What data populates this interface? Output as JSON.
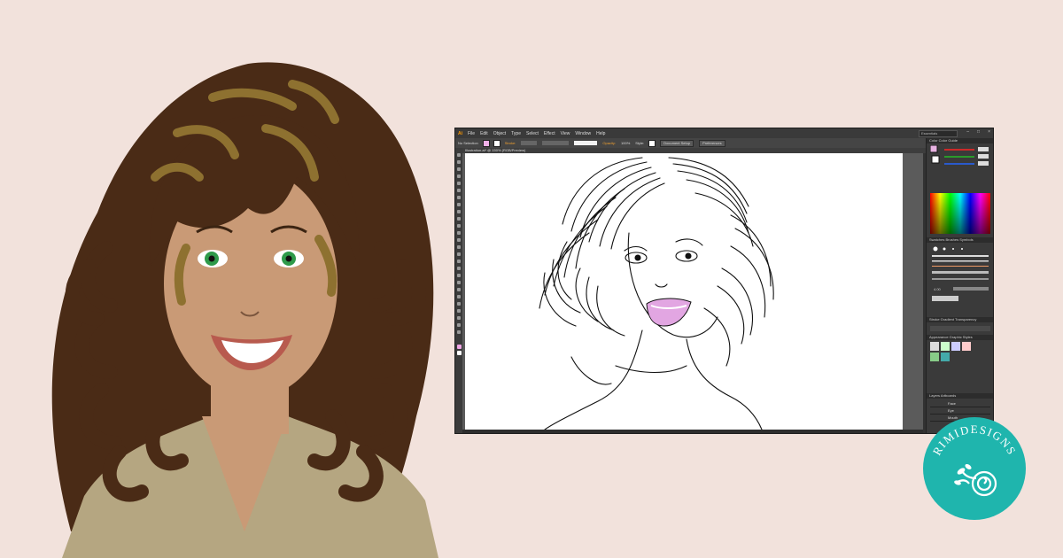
{
  "app": {
    "logo": "Ai",
    "menu": [
      "File",
      "Edit",
      "Object",
      "Type",
      "Select",
      "Effect",
      "View",
      "Window",
      "Help"
    ],
    "workspace": "Essentials",
    "window_controls": [
      "–",
      "□",
      "×"
    ]
  },
  "control_bar": {
    "selection": "No Selection",
    "stroke_label": "Stroke:",
    "opacity_label": "Opacity:",
    "opacity_value": "100%",
    "style_label": "Style:",
    "document_setup": "Document Setup",
    "preferences": "Preferences"
  },
  "document_tab": "Illustration.ai* @ 150% (RGB/Preview)",
  "panels": {
    "color_tabs": "Color   Color Guide",
    "brush_tabs": "Swatches   Brushes   Symbols",
    "brush_size": "4.00",
    "stroke_tabs": "Stroke   Gradient   Transparency",
    "appearance_tabs": "Appearance   Graphic Styles",
    "layers_tabs": "Layers   Artboards",
    "layers": [
      "Face",
      "Eye",
      "Mouth"
    ]
  },
  "brand": {
    "name": "RIMIDESIGNS"
  },
  "colors": {
    "background": "#f2e2dc",
    "badge": "#1fb5ad",
    "hair": "#4a2b16",
    "highlight": "#8e7130",
    "skin": "#c99a76",
    "shirt": "#b5a681",
    "eyes": "#2e9a4a",
    "lips_fill": "#e2a6e2"
  }
}
